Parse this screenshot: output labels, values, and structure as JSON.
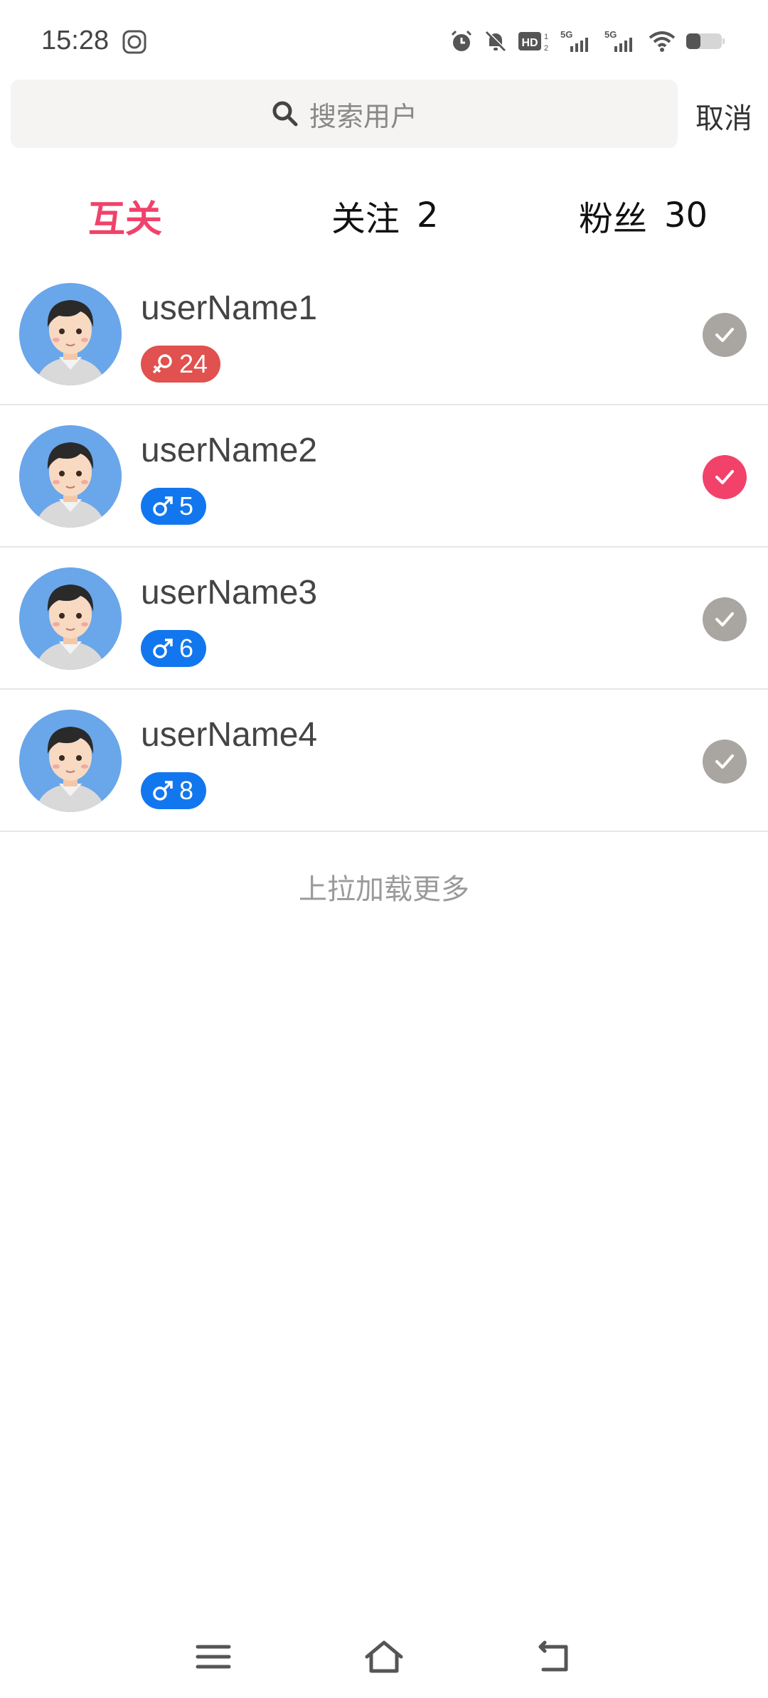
{
  "status_bar": {
    "time": "15:28",
    "icons": [
      "app-notification-icon",
      "alarm-icon",
      "mute-icon",
      "hd-icon",
      "signal-5g-icon",
      "signal-5g-icon",
      "wifi-icon",
      "battery-icon"
    ],
    "hd_label": "HD",
    "network_label": "5G"
  },
  "search": {
    "placeholder": "搜索用户",
    "cancel_label": "取消"
  },
  "tabs": [
    {
      "label": "互关",
      "count": "",
      "active": true
    },
    {
      "label": "关注",
      "count": "2",
      "active": false
    },
    {
      "label": "粉丝",
      "count": "30",
      "active": false
    }
  ],
  "users": [
    {
      "name": "userName1",
      "gender": "female",
      "age": "24",
      "selected": false
    },
    {
      "name": "userName2",
      "gender": "male",
      "age": "5",
      "selected": true
    },
    {
      "name": "userName3",
      "gender": "male",
      "age": "6",
      "selected": false
    },
    {
      "name": "userName4",
      "gender": "male",
      "age": "8",
      "selected": false
    }
  ],
  "load_more": "上拉加载更多",
  "colors": {
    "accent": "#f0426a",
    "female_badge": "#e0514f",
    "male_badge": "#1277ee",
    "check_unselected": "#a9a6a2",
    "check_selected": "#f2426a",
    "search_bg": "#f5f4f3"
  },
  "nav_bar": {
    "icons": [
      "menu-icon",
      "home-icon",
      "back-icon"
    ]
  }
}
